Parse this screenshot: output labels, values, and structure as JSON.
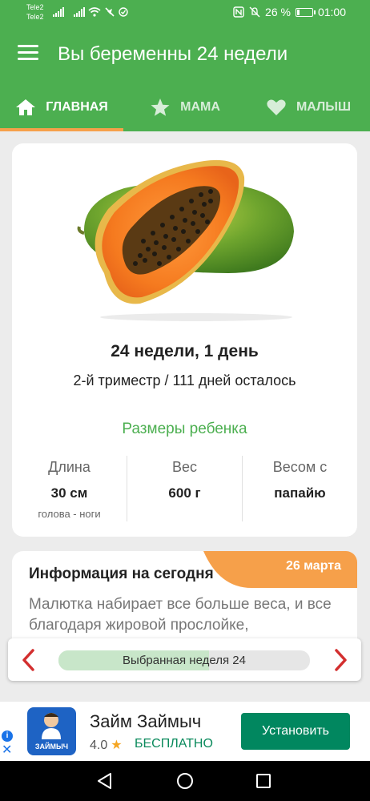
{
  "status_bar": {
    "carrier_1": "Tele2",
    "carrier_2": "Tele2",
    "battery": "26 %",
    "battery_level": 0.26,
    "time": "01:00"
  },
  "app_bar": {
    "title": "Вы беременны 24 недели",
    "menu_icon": "hamburger-menu-icon"
  },
  "tabs": [
    {
      "label": "ГЛАВНАЯ",
      "icon": "home-icon",
      "active": true
    },
    {
      "label": "МАМА",
      "icon": "star-icon",
      "active": false
    },
    {
      "label": "МАЛЫШ",
      "icon": "heart-icon",
      "active": false
    }
  ],
  "main_card": {
    "image_icon": "papaya-image",
    "week_title": "24 недели, 1 день",
    "trimester": "2-й триместр / 111 дней осталось",
    "sizes_heading": "Размеры ребенка",
    "stats": [
      {
        "label": "Длина",
        "value": "30 см",
        "sub": "голова - ноги"
      },
      {
        "label": "Вес",
        "value": "600 г",
        "sub": ""
      },
      {
        "label": "Весом с",
        "value": "папайю",
        "sub": ""
      }
    ]
  },
  "info_card": {
    "title": "Информация на сегодня",
    "date": "26 марта",
    "text": "Малютка набирает все больше веса, и все благодаря жировой прослойке,"
  },
  "week_selector": {
    "label": "Выбранная неделя 24",
    "progress": 0.6,
    "prev_icon": "chevron-left-icon",
    "next_icon": "chevron-right-icon"
  },
  "ad": {
    "title": "Займ Займыч",
    "rating": "4.0",
    "price": "БЕСПЛАТНО",
    "button": "Установить",
    "logo_text": "ЗАЙМЫЧ"
  },
  "colors": {
    "primary": "#4caf50",
    "accent": "#f6a04a",
    "chevron": "#d32f2f",
    "install": "#01875f"
  }
}
